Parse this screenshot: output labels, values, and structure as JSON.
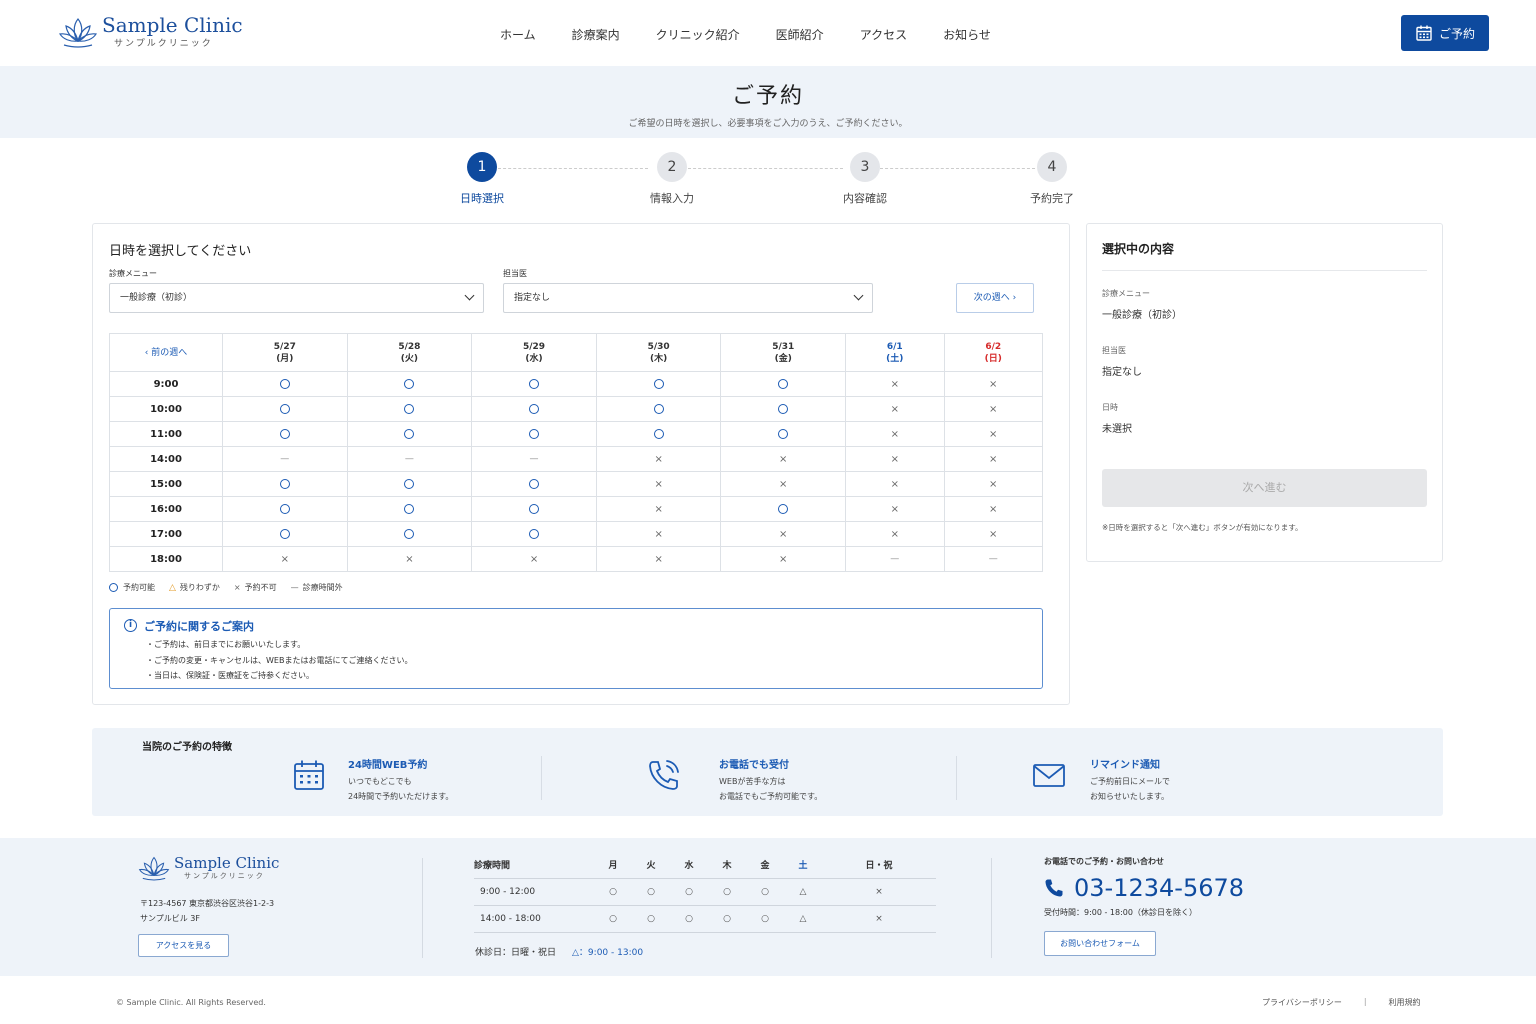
{
  "header": {
    "logo_main": "Sample Clinic",
    "logo_sub": "サンプルクリニック",
    "nav": [
      "ホーム",
      "診療案内",
      "クリニック紹介",
      "医師紹介",
      "アクセス",
      "お知らせ"
    ],
    "reserve_label": "ご予約"
  },
  "page": {
    "title": "ご予約",
    "subtitle": "ご希望の日時を選択し、必要事項をご入力のうえ、ご予約ください。"
  },
  "steps": [
    {
      "num": "1",
      "label": "日時選択",
      "active": true
    },
    {
      "num": "2",
      "label": "情報入力",
      "active": false
    },
    {
      "num": "3",
      "label": "内容確認",
      "active": false
    },
    {
      "num": "4",
      "label": "予約完了",
      "active": false
    }
  ],
  "selector": {
    "title": "日時を選択してください",
    "menu_label": "診療メニュー",
    "menu_value": "一般診療（初診）",
    "doctor_label": "担当医",
    "doctor_value": "指定なし",
    "next_week": "次の週へ ›",
    "prev_week": "‹ 前の週へ"
  },
  "schedule": {
    "days": [
      {
        "date": "5/27",
        "dow": "(月)",
        "type": "weekday"
      },
      {
        "date": "5/28",
        "dow": "(火)",
        "type": "weekday"
      },
      {
        "date": "5/29",
        "dow": "(水)",
        "type": "weekday"
      },
      {
        "date": "5/30",
        "dow": "(木)",
        "type": "weekday"
      },
      {
        "date": "5/31",
        "dow": "(金)",
        "type": "weekday"
      },
      {
        "date": "6/1",
        "dow": "(土)",
        "type": "sat"
      },
      {
        "date": "6/2",
        "dow": "(日)",
        "type": "sun"
      }
    ],
    "rows": [
      {
        "time": "9:00",
        "slots": [
          "o",
          "o",
          "o",
          "o",
          "o",
          "x",
          "x"
        ]
      },
      {
        "time": "10:00",
        "slots": [
          "o",
          "o",
          "o",
          "o",
          "o",
          "x",
          "x"
        ]
      },
      {
        "time": "11:00",
        "slots": [
          "o",
          "o",
          "o",
          "o",
          "o",
          "x",
          "x"
        ]
      },
      {
        "time": "14:00",
        "slots": [
          "-",
          "-",
          "-",
          "x",
          "x",
          "x",
          "x"
        ]
      },
      {
        "time": "15:00",
        "slots": [
          "o",
          "o",
          "o",
          "x",
          "x",
          "x",
          "x"
        ]
      },
      {
        "time": "16:00",
        "slots": [
          "o",
          "o",
          "o",
          "x",
          "o",
          "x",
          "x"
        ]
      },
      {
        "time": "17:00",
        "slots": [
          "o",
          "o",
          "o",
          "x",
          "x",
          "x",
          "x"
        ]
      },
      {
        "time": "18:00",
        "slots": [
          "x",
          "x",
          "x",
          "x",
          "x",
          "-",
          "-"
        ]
      }
    ],
    "symbols": {
      "x": "×",
      "-": "—"
    }
  },
  "legend": {
    "ok": "予約可能",
    "few_symbol": "△",
    "few": "残りわずか",
    "ng_symbol": "×",
    "ng": "予約不可",
    "out_symbol": "—",
    "out": "診療時間外"
  },
  "notice": {
    "icon": "i",
    "title": "ご予約に関するご案内",
    "items": [
      "・ご予約は、前日までにお願いいたします。",
      "・ご予約の変更・キャンセルは、WEBまたはお電話にてご連絡ください。",
      "・当日は、保険証・医療証をご持参ください。"
    ]
  },
  "summary": {
    "title": "選択中の内容",
    "menu_label": "診療メニュー",
    "menu_value": "一般診療（初診）",
    "doctor_label": "担当医",
    "doctor_value": "指定なし",
    "datetime_label": "日時",
    "datetime_value": "未選択",
    "next_button": "次へ進む",
    "note": "※日時を選択すると「次へ進む」ボタンが有効になります。"
  },
  "features": {
    "heading": "当院のご予約の特徴",
    "items": [
      {
        "icon": "calendar-icon",
        "title": "24時間WEB予約",
        "lines": [
          "いつでもどこでも",
          "24時間で予約いただけます。"
        ]
      },
      {
        "icon": "phone-icon",
        "title": "お電話でも受付",
        "lines": [
          "WEBが苦手な方は",
          "お電話でもご予約可能です。"
        ]
      },
      {
        "icon": "mail-icon",
        "title": "リマインド通知",
        "lines": [
          "ご予約前日にメールで",
          "お知らせいたします。"
        ]
      }
    ]
  },
  "footer": {
    "logo_main": "Sample Clinic",
    "logo_sub": "サンプルクリニック",
    "address": [
      "〒123-4567 東京都渋谷区渋谷1-2-3",
      "サンプルビル 3F"
    ],
    "access_button": "アクセスを見る",
    "hours_header": [
      "診療時間",
      "月",
      "火",
      "水",
      "木",
      "金",
      "土",
      "日・祝"
    ],
    "hours_rows": [
      [
        "9:00 - 12:00",
        "○",
        "○",
        "○",
        "○",
        "○",
        "△",
        "×"
      ],
      [
        "14:00 - 18:00",
        "○",
        "○",
        "○",
        "○",
        "○",
        "△",
        "×"
      ]
    ],
    "closed": "休診日：日曜・祝日",
    "closed_tri": "△：9:00 - 13:00",
    "tel_label": "お電話でのご予約・お問い合わせ",
    "tel": "03-1234-5678",
    "tel_hours": "受付時間：9:00 - 18:00（休診日を除く）",
    "form_button": "お問い合わせフォーム",
    "copyright": "© Sample Clinic. All Rights Reserved.",
    "links": [
      "プライバシーポリシー",
      "利用規約"
    ],
    "links_sep": "|"
  },
  "colors": {
    "primary": "#0e4a9e",
    "accent": "#1c5bb4",
    "sunday": "#d62b2b",
    "band": "#eef3f9"
  }
}
